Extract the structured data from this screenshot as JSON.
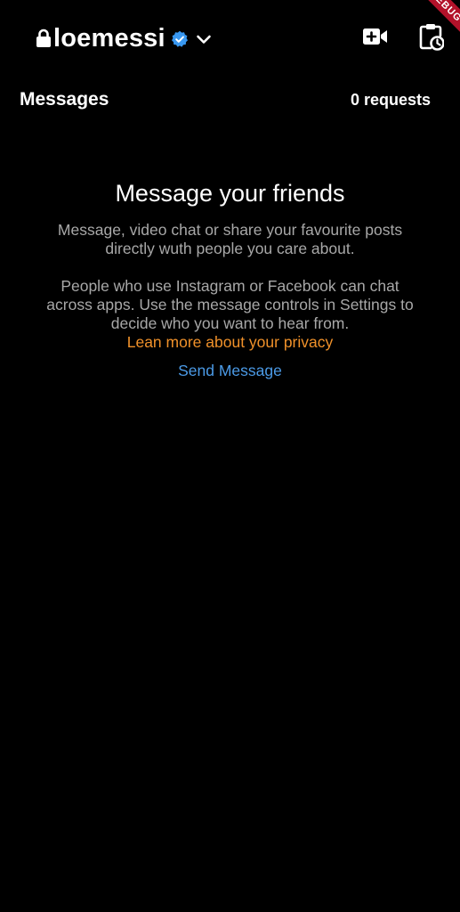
{
  "header": {
    "username": "loemessi",
    "icons": {
      "lock": "lock-icon",
      "verified": "verified-badge-icon",
      "dropdown": "chevron-down-icon",
      "video_call": "video-call-add-icon",
      "activity": "clipboard-clock-icon"
    },
    "debug_banner": "DEBUG"
  },
  "messages_section": {
    "title": "Messages",
    "requests": "0 requests"
  },
  "empty_state": {
    "title": "Message your friends",
    "description": "Message, video chat or share your favourite posts directly wuth people you care about.",
    "cross_app_notice": "People who use Instagram or Facebook can chat across apps. Use the message controls in Settings to decide who you want to hear from.",
    "privacy_link": "Lean more about your privacy",
    "send_button": "Send Message"
  },
  "colors": {
    "background": "#000000",
    "primary_text": "#ffffff",
    "secondary_text": "#a8a8a8",
    "link_orange": "#f0912a",
    "link_blue": "#4b9ae6",
    "verified_blue": "#3897f0",
    "debug_red": "#b3122a"
  }
}
